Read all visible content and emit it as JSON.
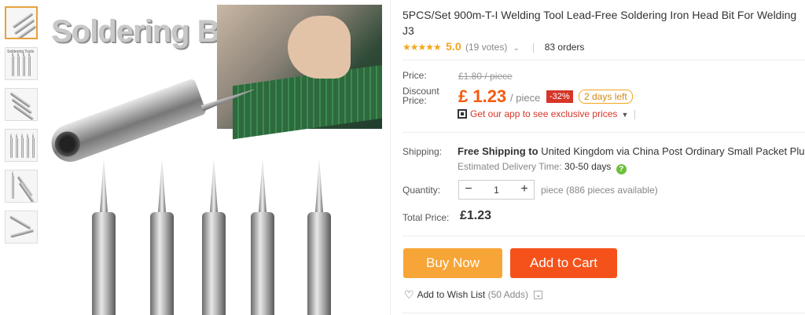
{
  "gallery": {
    "thumb_count": 6,
    "active_thumb": 0,
    "thumb_captions": [
      "Soldering Tools"
    ],
    "main_image_title": "Soldering Bit"
  },
  "product": {
    "title": "5PCS/Set 900m-T-I Welding Tool Lead-Free Soldering Iron Head Bit For Welding J3",
    "stars": "★★★★★",
    "score": "5.0",
    "votes": "(19 votes)",
    "orders": "83 orders"
  },
  "price": {
    "price_label": "Price:",
    "original": "£1.80 / piece",
    "discount_label_1": "Discount",
    "discount_label_2": "Price:",
    "current": "£ 1.23",
    "unit": "/ piece",
    "discount_badge": "-32%",
    "time_left": "2 days left",
    "app_promo": "Get our app to see exclusive prices"
  },
  "shipping": {
    "label": "Shipping:",
    "free_text": "Free Shipping to",
    "rest_text": "United Kingdom via China Post Ordinary Small Packet Plus",
    "est_label": "Estimated Delivery Time:",
    "est_days": "30-50 days"
  },
  "quantity": {
    "label": "Quantity:",
    "minus": "−",
    "value": "1",
    "plus": "+",
    "available": "piece (886 pieces available)"
  },
  "total": {
    "label": "Total Price:",
    "value": "£1.23"
  },
  "actions": {
    "buy_now": "Buy Now",
    "add_to_cart": "Add to Cart",
    "wishlist": "Add to Wish List",
    "wishlist_count": "(50 Adds)"
  },
  "colors": {
    "price": "#f55a0f",
    "buy_now": "#f7a537",
    "add_to_cart": "#f5521b",
    "star": "#f3a619",
    "discount_badge": "#d63628"
  }
}
